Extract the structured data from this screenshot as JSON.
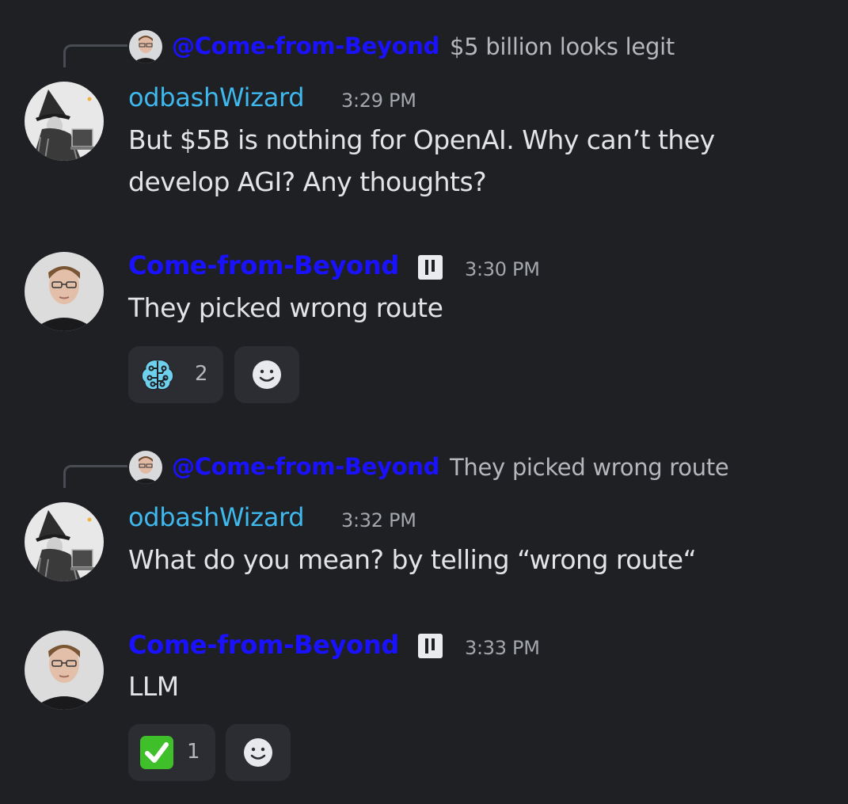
{
  "messages": [
    {
      "reply": {
        "mention": "@Come-from-Beyond",
        "text": "$5 billion looks legit"
      },
      "author": "odbashWizard",
      "time": "3:29 PM",
      "lines": [
        "But $5B is nothing for OpenAI. Why can’t they",
        "develop AGI? Any thoughts?"
      ]
    },
    {
      "author": "Come-from-Beyond",
      "time": "3:30 PM",
      "lines": [
        "They picked wrong route"
      ],
      "reaction": {
        "emoji": "brain-icon",
        "count": "2"
      }
    },
    {
      "reply": {
        "mention": "@Come-from-Beyond",
        "text": "They picked wrong route"
      },
      "author": "odbashWizard",
      "time": "3:32 PM",
      "lines": [
        "What do you mean? by telling “wrong route“"
      ]
    },
    {
      "author": "Come-from-Beyond",
      "time": "3:33 PM",
      "lines": [
        "LLM"
      ],
      "reaction": {
        "emoji": "check-mark-icon",
        "count": "1"
      }
    }
  ],
  "colors": {
    "background": "#1f2024",
    "wizard_name": "#3fb8ee",
    "beyond_name": "#1a11ff",
    "reaction_bg": "#2c2d33"
  }
}
